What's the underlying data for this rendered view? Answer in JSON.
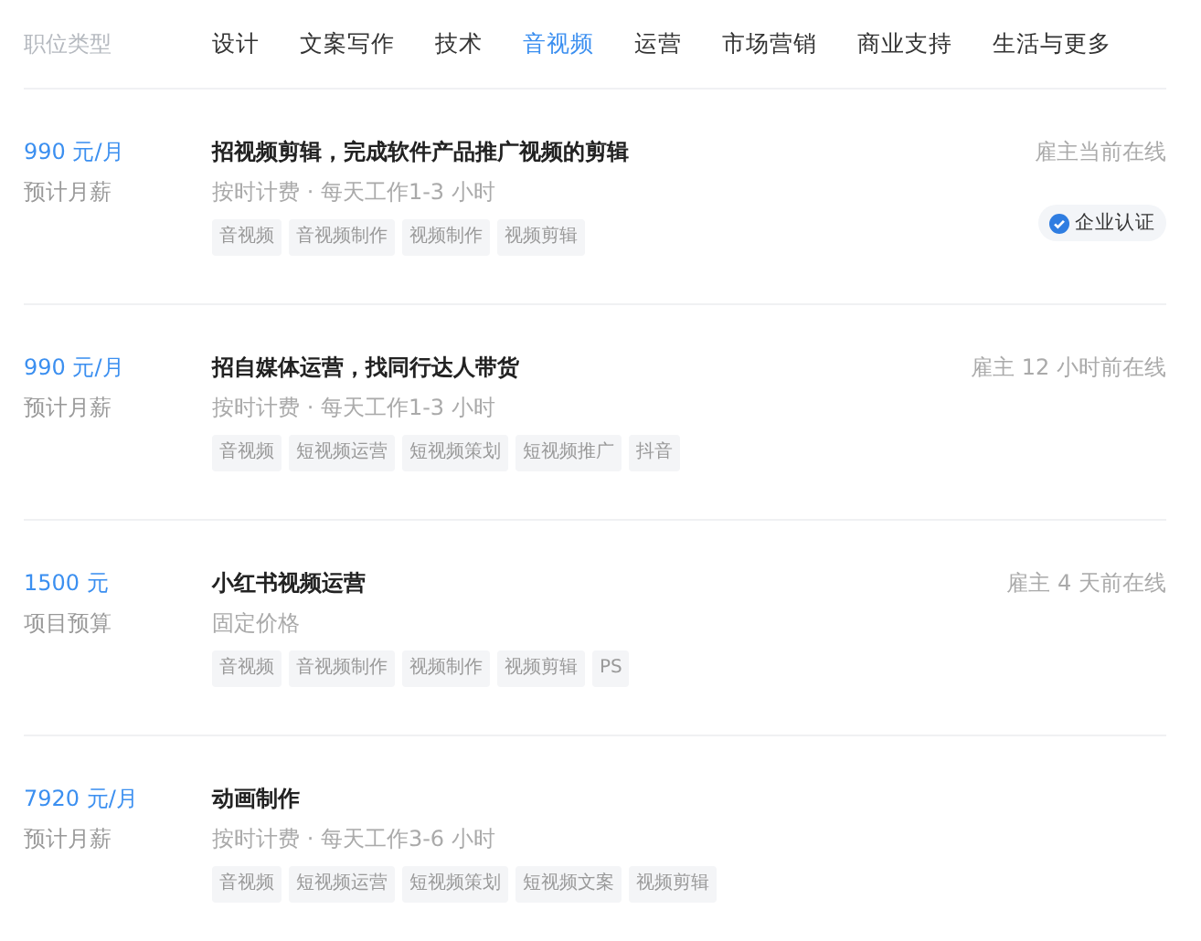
{
  "category_label": "职位类型",
  "tabs": [
    {
      "label": "设计",
      "selected": false
    },
    {
      "label": "文案写作",
      "selected": false
    },
    {
      "label": "技术",
      "selected": false
    },
    {
      "label": "音视频",
      "selected": true
    },
    {
      "label": "运营",
      "selected": false
    },
    {
      "label": "市场营销",
      "selected": false
    },
    {
      "label": "商业支持",
      "selected": false
    },
    {
      "label": "生活与更多",
      "selected": false
    }
  ],
  "jobs": [
    {
      "price": "990 元/月",
      "price_type": "预计月薪",
      "title": "招视频剪辑，完成软件产品推广视频的剪辑",
      "terms": "按时计费 · 每天工作1-3 小时",
      "tags": [
        "音视频",
        "音视频制作",
        "视频制作",
        "视频剪辑"
      ],
      "online": "雇主当前在线",
      "verified": "企业认证"
    },
    {
      "price": "990 元/月",
      "price_type": "预计月薪",
      "title": "招自媒体运营，找同行达人带货",
      "terms": "按时计费 · 每天工作1-3 小时",
      "tags": [
        "音视频",
        "短视频运营",
        "短视频策划",
        "短视频推广",
        "抖音"
      ],
      "online": "雇主 12 小时前在线"
    },
    {
      "price": "1500 元",
      "price_type": "项目预算",
      "title": "小红书视频运营",
      "terms": "固定价格",
      "tags": [
        "音视频",
        "音视频制作",
        "视频制作",
        "视频剪辑",
        "PS"
      ],
      "online": "雇主 4 天前在线"
    },
    {
      "price": "7920 元/月",
      "price_type": "预计月薪",
      "title": "动画制作",
      "terms": "按时计费 · 每天工作3-6 小时",
      "tags": [
        "音视频",
        "短视频运营",
        "短视频策划",
        "短视频文案",
        "视频剪辑"
      ]
    }
  ]
}
